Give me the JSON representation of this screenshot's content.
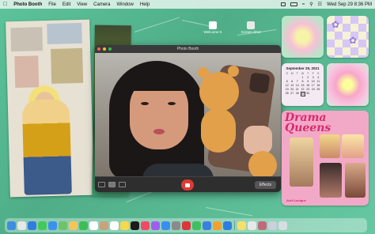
{
  "menubar": {
    "app_name": "Photo Booth",
    "menus": [
      "File",
      "Edit",
      "View",
      "Camera",
      "Window",
      "Help"
    ],
    "datetime": "Wed Sep 29  8:36 PM"
  },
  "desktop_icons": [
    {
      "label": "Welcome K",
      "color": "#ffffff"
    },
    {
      "label": "Screen Shot",
      "color": "#ffffff"
    }
  ],
  "window": {
    "title": "Photo Booth",
    "effects_label": "Effects"
  },
  "calendar": {
    "title": "September 29, 2021",
    "days": [
      "S",
      "M",
      "T",
      "W",
      "T",
      "F",
      "S"
    ],
    "dates": [
      "",
      "",
      "",
      "1",
      "2",
      "3",
      "4",
      "5",
      "6",
      "7",
      "8",
      "9",
      "10",
      "11",
      "12",
      "13",
      "14",
      "15",
      "16",
      "17",
      "18",
      "19",
      "20",
      "21",
      "22",
      "23",
      "24",
      "25",
      "26",
      "27",
      "28",
      "29",
      "30",
      "",
      ""
    ],
    "today": "29"
  },
  "magazine": {
    "title": "Drama Queens",
    "caption": "Avril Lavigne"
  },
  "dock": {
    "apps": [
      {
        "name": "finder",
        "color": "#3b8ee0"
      },
      {
        "name": "launchpad",
        "color": "#e7e7e7"
      },
      {
        "name": "safari",
        "color": "#2f7de0"
      },
      {
        "name": "messages",
        "color": "#42c95a"
      },
      {
        "name": "mail",
        "color": "#3a91ef"
      },
      {
        "name": "maps",
        "color": "#6fc26b"
      },
      {
        "name": "photos",
        "color": "#f4c65a"
      },
      {
        "name": "facetime",
        "color": "#3dbd52"
      },
      {
        "name": "calendar",
        "color": "#ffffff"
      },
      {
        "name": "contacts",
        "color": "#c9a27a"
      },
      {
        "name": "reminders",
        "color": "#ffffff"
      },
      {
        "name": "notes",
        "color": "#f7d94c"
      },
      {
        "name": "tv",
        "color": "#1b1b1b"
      },
      {
        "name": "music",
        "color": "#f04a66"
      },
      {
        "name": "podcasts",
        "color": "#9e5ef0"
      },
      {
        "name": "app-store",
        "color": "#3a8ef0"
      },
      {
        "name": "system-preferences",
        "color": "#8a8a8a"
      },
      {
        "name": "photo-booth",
        "color": "#d9373a"
      },
      {
        "name": "numbers",
        "color": "#3fbf61"
      },
      {
        "name": "keynote",
        "color": "#3a80e0"
      },
      {
        "name": "pages",
        "color": "#f49f30"
      },
      {
        "name": "xcode",
        "color": "#2d7de0"
      }
    ],
    "right_apps": [
      {
        "name": "notes-stack",
        "color": "#f5e06a"
      },
      {
        "name": "chrome",
        "color": "#e8e8e8"
      },
      {
        "name": "photo-booth-thumb",
        "color": "#c06a7a"
      },
      {
        "name": "downloads",
        "color": "#c9d1da"
      },
      {
        "name": "trash",
        "color": "#d7dde3"
      }
    ]
  }
}
